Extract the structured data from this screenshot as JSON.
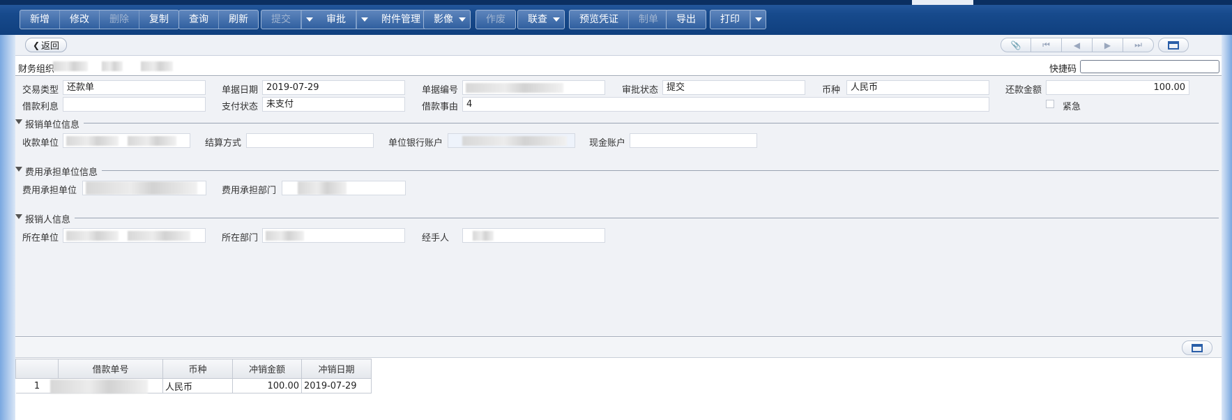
{
  "toolbar": {
    "add": "新增",
    "modify": "修改",
    "delete": "删除",
    "copy": "复制",
    "query": "查询",
    "refresh": "刷新",
    "submit": "提交",
    "approve": "审批",
    "attachment": "附件管理",
    "image": "影像",
    "void": "作废",
    "link_query": "联查",
    "preview_voucher": "预览凭证",
    "make_voucher": "制单",
    "export": "导出",
    "print": "打印"
  },
  "nav": {
    "back_label": "返回",
    "icons": [
      "paperclip-icon",
      "first-page-icon",
      "prev-page-icon",
      "next-page-icon",
      "last-page-icon",
      "window-icon"
    ]
  },
  "org": {
    "label": "财务组织",
    "shortcut_label": "快捷码",
    "shortcut_value": ""
  },
  "form": {
    "trade_type_label": "交易类型",
    "trade_type_value": "还款单",
    "bill_date_label": "单据日期",
    "bill_date_value": "2019-07-29",
    "bill_no_label": "单据编号",
    "approve_status_label": "审批状态",
    "approve_status_value": "提交",
    "currency_label": "币种",
    "currency_value": "人民币",
    "repay_amount_label": "还款金额",
    "repay_amount_value": "100.00",
    "loan_interest_label": "借款利息",
    "loan_interest_value": "",
    "pay_status_label": "支付状态",
    "pay_status_value": "未支付",
    "loan_reason_label": "借款事由",
    "loan_reason_value": "4",
    "urgent_label": "紧急"
  },
  "sections": {
    "reimburse_unit": {
      "title": "报销单位信息",
      "payee_unit_label": "收款单位",
      "settle_method_label": "结算方式",
      "settle_method_value": "",
      "unit_bank_label": "单位银行账户",
      "cash_account_label": "现金账户",
      "cash_account_value": ""
    },
    "expense_unit": {
      "title": "费用承担单位信息",
      "unit_label": "费用承担单位",
      "dept_label": "费用承担部门"
    },
    "reimburser": {
      "title": "报销人信息",
      "unit_label": "所在单位",
      "dept_label": "所在部门",
      "handler_label": "经手人"
    }
  },
  "grid": {
    "columns": [
      "借款单号",
      "币种",
      "冲销金额",
      "冲销日期"
    ],
    "rows": [
      {
        "index": "1",
        "loan_no": "",
        "currency": "人民币",
        "amount": "100.00",
        "date": "2019-07-29"
      }
    ]
  },
  "colors": {
    "toolbar_blue": "#174a8c",
    "form_bg": "#f0f2f6"
  }
}
